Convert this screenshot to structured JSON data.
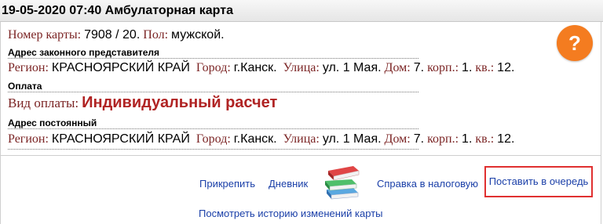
{
  "header": {
    "title": "19-05-2020 07:40 Амбулаторная карта",
    "help_label": "?"
  },
  "card": {
    "number_label": "Номер карты:",
    "number_value": "7908 / 20.",
    "sex_label": "Пол:",
    "sex_value": "мужской."
  },
  "legal_address": {
    "title": "Адрес законного представителя",
    "region_label": "Регион:",
    "region_value": "КРАСНОЯРСКИЙ КРАЙ",
    "city_label": "Город:",
    "city_value": "г.Канск.",
    "street_label": "Улица:",
    "street_value": "ул. 1 Мая.",
    "house_label": "Дом:",
    "house_value": "7.",
    "building_label": "корп.:",
    "building_value": "1.",
    "apt_label": "кв.:",
    "apt_value": "12."
  },
  "payment": {
    "title": "Оплата",
    "type_label": "Вид оплаты:",
    "type_value": "Индивидуальный расчет"
  },
  "permanent_address": {
    "title": "Адрес постоянный",
    "region_label": "Регион:",
    "region_value": "КРАСНОЯРСКИЙ КРАЙ",
    "city_label": "Город:",
    "city_value": "г.Канск.",
    "street_label": "Улица:",
    "street_value": "ул. 1 Мая.",
    "house_label": "Дом:",
    "house_value": "7.",
    "building_label": "корп.:",
    "building_value": "1.",
    "apt_label": "кв.:",
    "apt_value": "12."
  },
  "actions": {
    "attach": "Прикрепить",
    "diary": "Дневник",
    "tax_certificate": "Справка в налоговую",
    "queue": "Поставить в очередь",
    "history": "Посмотреть историю изменений карты"
  },
  "icons": {
    "books": "books-icon"
  },
  "colors": {
    "label": "#7b2424",
    "payment_value": "#b02323",
    "link": "#1a3fa8",
    "help_button": "#f47c20",
    "highlight_border": "#e03030"
  }
}
